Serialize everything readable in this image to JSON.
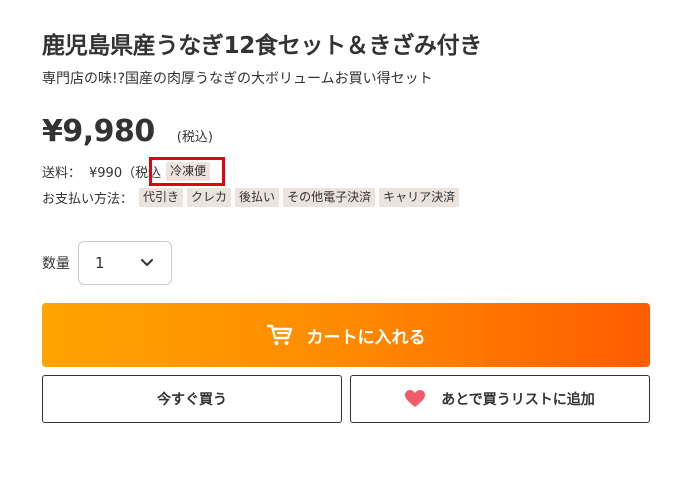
{
  "product": {
    "title": "鹿児島県産うなぎ12食セット＆きざみ付き",
    "subtitle": "専門店の味!?国産の肉厚うなぎの大ボリュームお買い得セット",
    "price": "¥9,980",
    "tax_note": "(税込)"
  },
  "shipping": {
    "label": "送料：",
    "value": "¥990（税込",
    "tag": "冷凍便"
  },
  "payment": {
    "label": "お支払い方法：",
    "methods": [
      "代引き",
      "クレカ",
      "後払い",
      "その他電子決済",
      "キャリア決済"
    ]
  },
  "quantity": {
    "label": "数量",
    "value": "1"
  },
  "actions": {
    "add_to_cart": "カートに入れる",
    "buy_now": "今すぐ買う",
    "wishlist": "あとで買うリストに追加"
  },
  "icons": {
    "cart": "cart-icon",
    "heart": "heart-icon",
    "chevron": "chevron-down-icon"
  },
  "colors": {
    "cart_gradient_start": "#ffa400",
    "cart_gradient_end": "#ff5c00",
    "highlight_border": "#e60012",
    "heart": "#f25c68",
    "tag_bg": "#ebe3dc"
  }
}
